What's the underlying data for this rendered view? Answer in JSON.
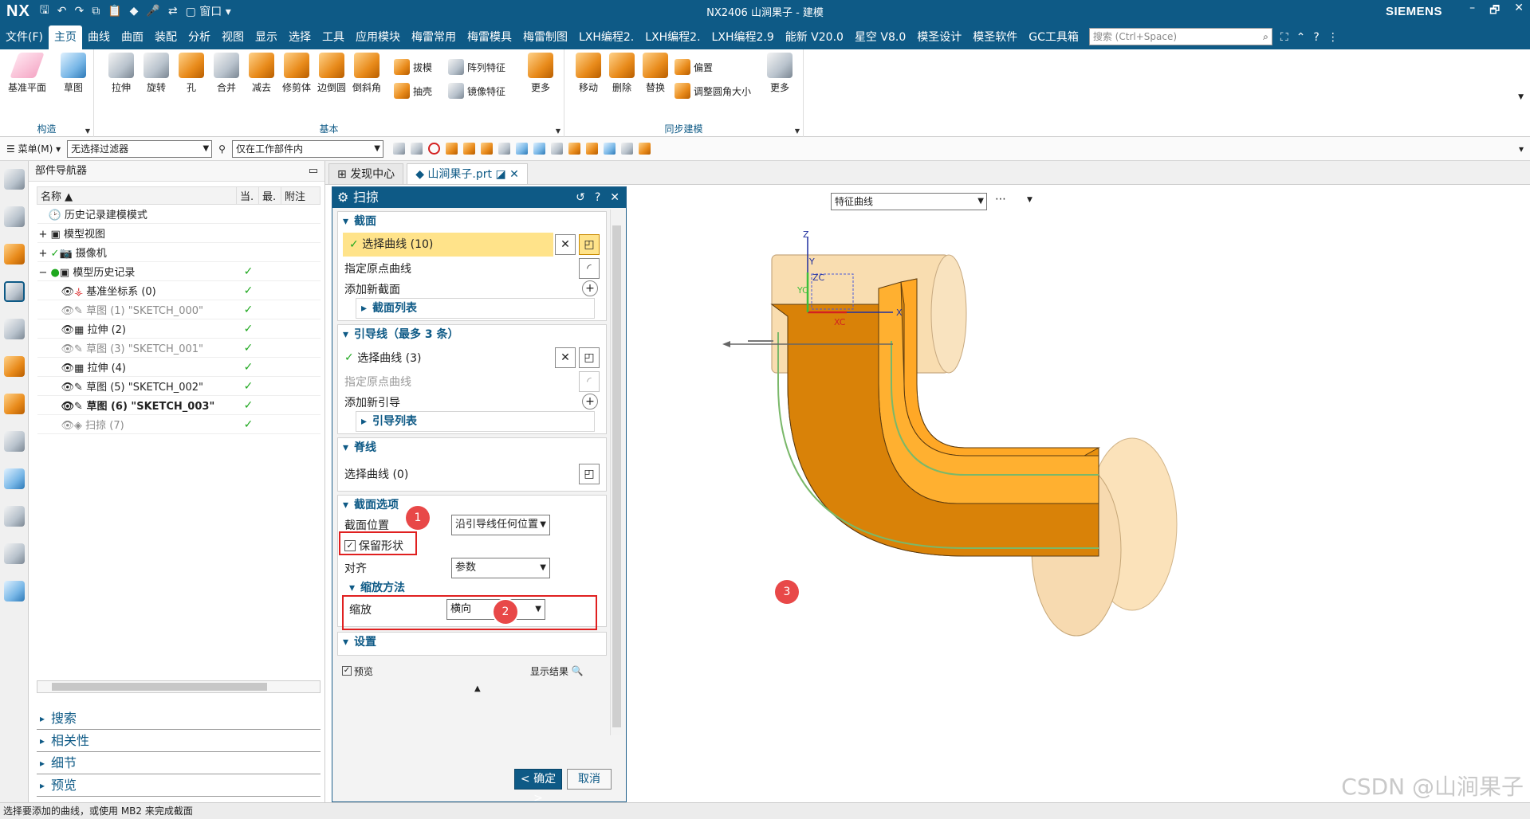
{
  "titlebar": {
    "logo": "NX",
    "title": "NX2406 山涧果子 - 建模",
    "brand": "SIEMENS",
    "window_menu": "窗口",
    "controls": [
      "–",
      "🗗",
      "✕"
    ]
  },
  "menubar": {
    "items": [
      "文件(F)",
      "主页",
      "曲线",
      "曲面",
      "装配",
      "分析",
      "视图",
      "显示",
      "选择",
      "工具",
      "应用模块",
      "梅雷常用",
      "梅雷模具",
      "梅雷制图",
      "LXH编程2.",
      "LXH编程2.",
      "LXH编程2.9",
      "能新 V20.0",
      "星空 V8.0",
      "模圣设计",
      "模圣软件",
      "GC工具箱"
    ],
    "active": "主页",
    "search_placeholder": "搜索 (Ctrl+Space)"
  },
  "ribbon": {
    "groups": {
      "construct": {
        "label": "构造",
        "buttons": [
          "基准平面",
          "草图"
        ]
      },
      "basic": {
        "label": "基本",
        "buttons": [
          "拉伸",
          "旋转",
          "孔",
          "合并",
          "减去",
          "修剪体",
          "边倒圆",
          "倒斜角"
        ],
        "small": [
          "拔模",
          "阵列特征",
          "抽壳",
          "镜像特征"
        ],
        "more": "更多"
      },
      "sync": {
        "label": "同步建模",
        "buttons": [
          "移动",
          "删除",
          "替换"
        ],
        "small": [
          "偏置",
          "调整圆角大小"
        ],
        "more": "更多"
      }
    }
  },
  "filterbar": {
    "menu": "菜单(M)",
    "filter": "无选择过滤器",
    "scope": "仅在工作部件内"
  },
  "navigator": {
    "title": "部件导航器",
    "columns": [
      "名称",
      "当.",
      "最.",
      "附注"
    ],
    "rows": [
      {
        "name": "历史记录建模模式",
        "check": "",
        "style": "normal"
      },
      {
        "name": "模型视图",
        "check": "",
        "style": "normal"
      },
      {
        "name": "摄像机",
        "check": "",
        "style": "normal"
      },
      {
        "name": "模型历史记录",
        "check": "✓",
        "style": "normal"
      },
      {
        "name": "基准坐标系 (0)",
        "check": "✓",
        "style": "normal"
      },
      {
        "name": "草图 (1) \"SKETCH_000\"",
        "check": "✓",
        "style": "dim"
      },
      {
        "name": "拉伸 (2)",
        "check": "✓",
        "style": "normal"
      },
      {
        "name": "草图 (3) \"SKETCH_001\"",
        "check": "✓",
        "style": "dim"
      },
      {
        "name": "拉伸 (4)",
        "check": "✓",
        "style": "normal"
      },
      {
        "name": "草图 (5) \"SKETCH_002\"",
        "check": "✓",
        "style": "normal"
      },
      {
        "name": "草图 (6) \"SKETCH_003\"",
        "check": "✓",
        "style": "bold"
      },
      {
        "name": "扫掠 (7)",
        "check": "✓",
        "style": "dim"
      }
    ],
    "sections": [
      "搜索",
      "相关性",
      "细节",
      "预览"
    ]
  },
  "tabs": [
    "发现中心",
    "山涧果子.prt"
  ],
  "dialog": {
    "title": "扫掠",
    "section_panel": {
      "header": "截面",
      "select_curve": "选择曲线 (10)",
      "origin_curve": "指定原点曲线",
      "add_new": "添加新截面",
      "list": "截面列表"
    },
    "guide_panel": {
      "header": "引导线（最多 3 条）",
      "select_curve": "选择曲线 (3)",
      "origin_curve": "指定原点曲线",
      "add_new": "添加新引导",
      "list": "引导列表"
    },
    "spine_panel": {
      "header": "脊线",
      "select_curve": "选择曲线 (0)"
    },
    "options_panel": {
      "header": "截面选项",
      "position_label": "截面位置",
      "position_value": "沿引导线任何位置",
      "preserve_shape": "保留形状",
      "align_label": "对齐",
      "align_value": "参数",
      "scale_method": "缩放方法",
      "scale_label": "缩放",
      "scale_value": "横向"
    },
    "settings": "设置",
    "preview": "预览",
    "show_result": "显示结果",
    "ok": "< 确定 >",
    "cancel": "取消"
  },
  "badges": [
    "1",
    "2",
    "3"
  ],
  "viewport": {
    "curve_filter": "特征曲线",
    "axes": {
      "z": "Z",
      "y": "Y",
      "zc": "ZC",
      "yc": "YC",
      "x": "X",
      "xc": "XC"
    }
  },
  "status": "选择要添加的曲线，或使用 MB2 来完成截面",
  "watermark": "CSDN @山涧果子",
  "colors": {
    "accent": "#0e5a86",
    "highlight": "#ffe38a",
    "badge": "#e84848",
    "body": "#e8900e"
  }
}
